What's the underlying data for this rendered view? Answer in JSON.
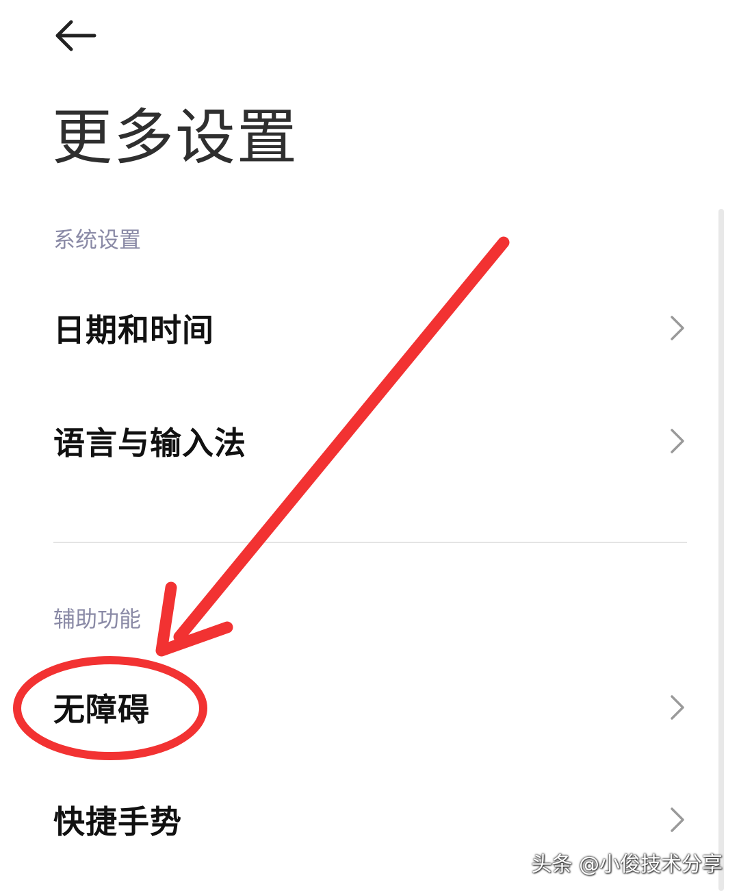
{
  "header": {
    "back_icon": "arrow-left-icon",
    "title": "更多设置"
  },
  "sections": [
    {
      "header": "系统设置",
      "items": [
        {
          "label": "日期和时间",
          "icon": "chevron-right-icon"
        },
        {
          "label": "语言与输入法",
          "icon": "chevron-right-icon"
        }
      ]
    },
    {
      "header": "辅助功能",
      "items": [
        {
          "label": "无障碍",
          "icon": "chevron-right-icon"
        },
        {
          "label": "快捷手势",
          "icon": "chevron-right-icon"
        }
      ]
    }
  ],
  "annotation": {
    "color": "#f23232",
    "highlighted_item": "无障碍"
  },
  "watermark": "头条 @小俊技术分享"
}
